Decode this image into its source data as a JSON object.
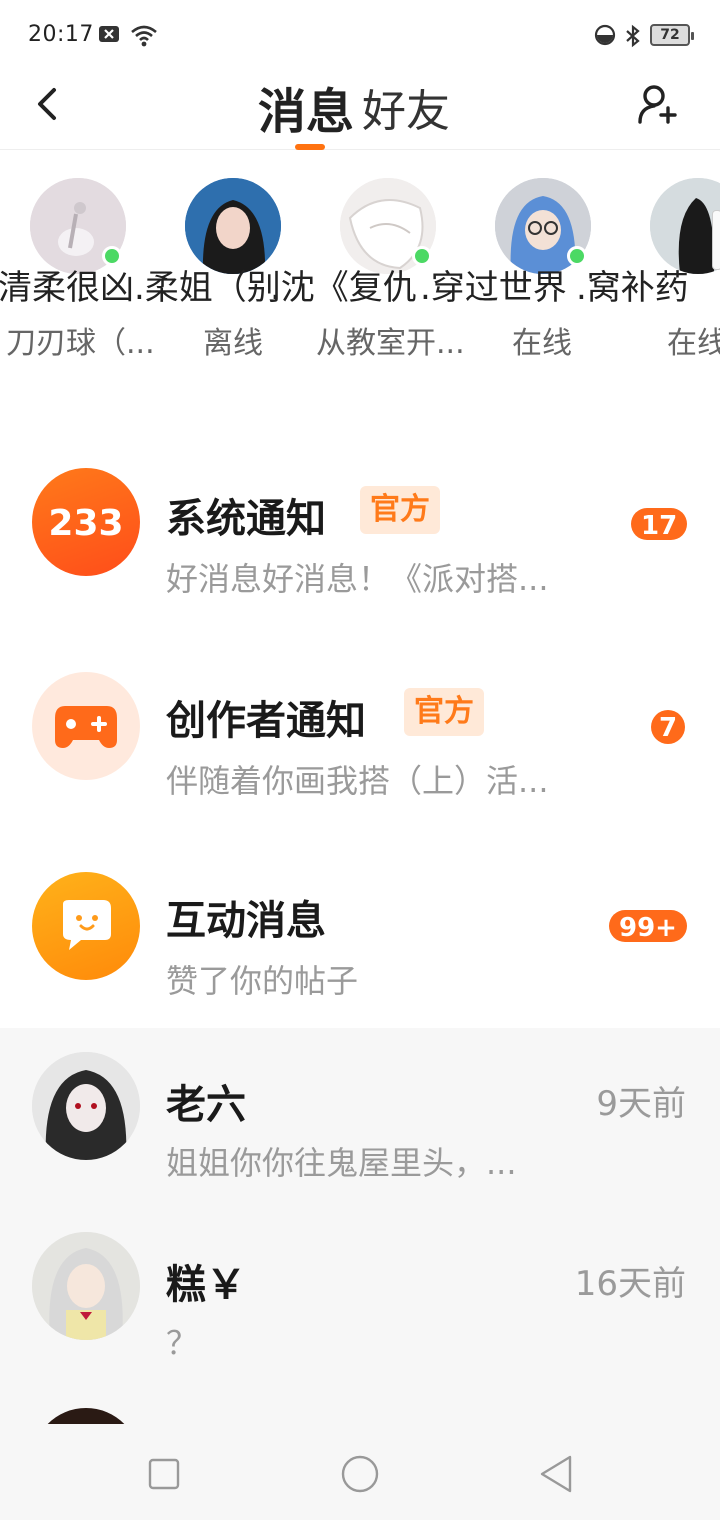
{
  "status_bar": {
    "time": "20:17",
    "battery": "72",
    "icons": [
      "close-box-icon",
      "wifi-icon",
      "dnd-icon",
      "bluetooth-icon",
      "battery-icon"
    ]
  },
  "header": {
    "tabs": [
      {
        "label": "消息",
        "active": true
      },
      {
        "label": "好友",
        "active": false
      }
    ],
    "accent": "#ff7210"
  },
  "friends": [
    {
      "name": "清柔很凶.柔姐（别",
      "status": "刀刃球（...",
      "online": true
    },
    {
      "name": ".沈《复仇",
      "status": "离线",
      "online": false
    },
    {
      "name": ".穿过世界",
      "status": "从教室开...",
      "online": true
    },
    {
      "name": ".窝补药",
      "status": "在线",
      "online": true
    },
    {
      "name": "",
      "status": "在线",
      "online": false
    }
  ],
  "notifications": [
    {
      "title": "系统通知",
      "badge": "官方",
      "preview": "好消息好消息！《派对搭...",
      "unread": "17",
      "icon": "233-logo-icon"
    },
    {
      "title": "创作者通知",
      "badge": "官方",
      "preview": "伴随着你画我搭（上）活...",
      "unread": "7",
      "icon": "gamepad-icon"
    },
    {
      "title": "互动消息",
      "badge": "",
      "preview": "赞了你的帖子",
      "unread": "99+",
      "icon": "chat-bubble-icon"
    }
  ],
  "chats": [
    {
      "name": "老六",
      "time": "9天前",
      "preview": "姐姐你你往鬼屋里头，..."
    },
    {
      "name": "糕￥",
      "time": "16天前",
      "preview": "？"
    }
  ]
}
